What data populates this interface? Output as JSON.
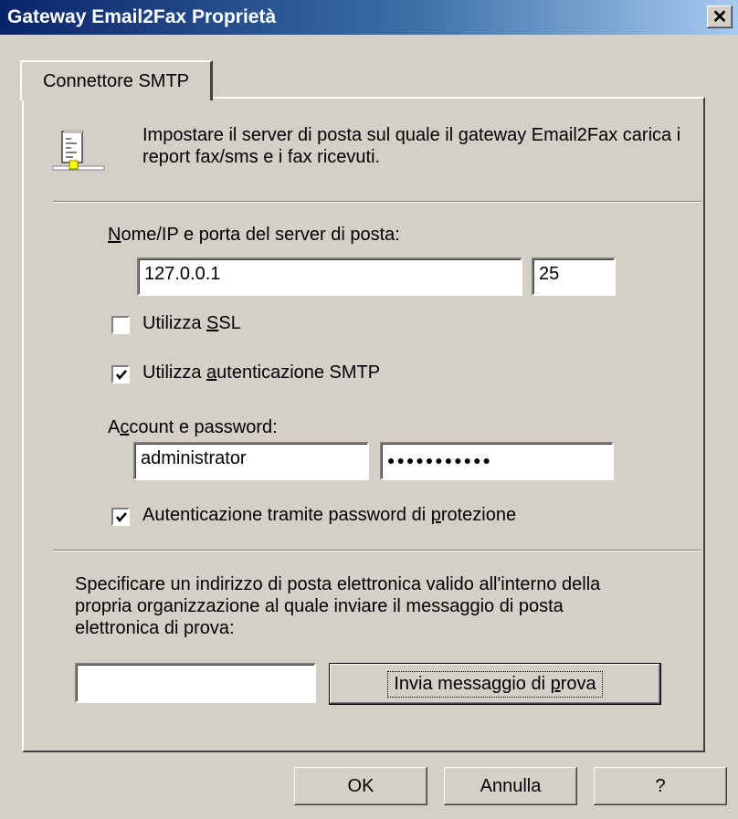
{
  "window": {
    "title": "Gateway Email2Fax Proprietà",
    "close_glyph": "✕"
  },
  "tab": {
    "label": "Connettore SMTP"
  },
  "intro": {
    "icon": "document-server-icon",
    "text_line1": "Impostare il server di posta sul quale il gateway Email2Fax carica i",
    "text_line2": "report fax/sms e i fax ricevuti."
  },
  "server": {
    "label_first": "N",
    "label_rest": "ome/IP e porta del server di posta:",
    "host": "127.0.0.1",
    "port": "25"
  },
  "ssl": {
    "label_pre": "Utilizza ",
    "label_ul": "S",
    "label_post": "SL",
    "checked": false
  },
  "smtp_auth": {
    "label_pre": "Utilizza ",
    "label_ul": "a",
    "label_post": "utenticazione SMTP",
    "checked": true
  },
  "account": {
    "label_pre": "A",
    "label_ul": "c",
    "label_post": "count e password:",
    "username": "administrator",
    "password_mask": "●●●●●●●●●●●"
  },
  "secure_auth": {
    "label_pre": "Autenticazione tramite password di ",
    "label_ul": "p",
    "label_post": "rotezione",
    "checked": true
  },
  "test": {
    "text_line1": "Specificare un indirizzo di posta elettronica valido all'interno della",
    "text_line2": "propria organizzazione al quale inviare il messaggio di posta",
    "text_line3": "elettronica di prova:",
    "email": "",
    "button_pre": "Invia messaggio di ",
    "button_ul": "p",
    "button_post": "rova"
  },
  "footer": {
    "ok": "OK",
    "cancel": "Annulla",
    "help": "?"
  }
}
